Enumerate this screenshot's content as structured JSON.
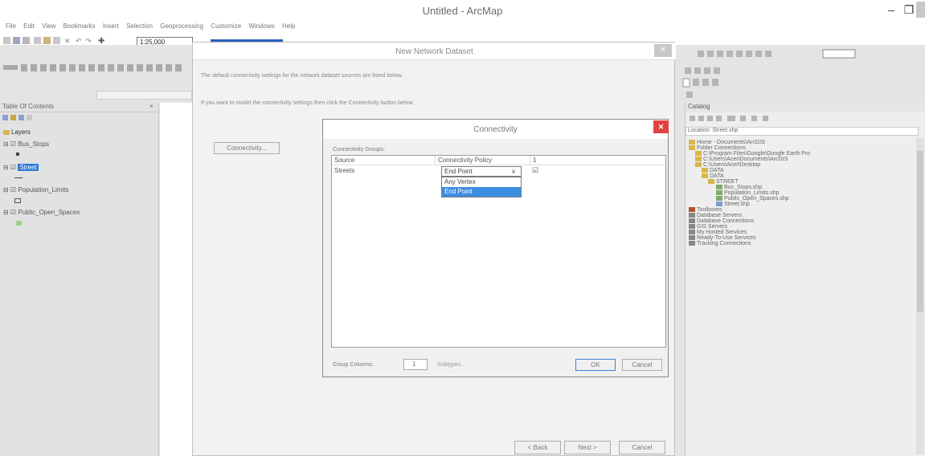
{
  "window": {
    "title": "Untitled - ArcMap",
    "minimize": "–",
    "restore": "❐"
  },
  "menubar": [
    "File",
    "Edit",
    "View",
    "Bookmarks",
    "Insert",
    "Selection",
    "Geoprocessing",
    "Customize",
    "Windows",
    "Help"
  ],
  "toolbar": {
    "scale": "1:25,000"
  },
  "toc": {
    "header": "Table Of Contents",
    "layers_label": "Layers",
    "items": [
      "Bus_Stops",
      "Street",
      "Population_Limits",
      "Public_Open_Spaces"
    ]
  },
  "catalog": {
    "header": "Catalog",
    "location_label": "Location:",
    "location_value": "Street.shp",
    "tree": [
      "Home - Documents\\ArcGIS",
      "Folder Connections",
      "C:\\Program Files\\Google\\Google Earth Pro",
      "C:\\Users\\Acer\\Documents\\ArcGIS",
      "C:\\Users\\Acer\\Desktop",
      "DATA",
      "DATA",
      "STREET",
      "Bus_Stops.shp",
      "Population_Limits.shp",
      "Public_Open_Spaces.shp",
      "Street.shp",
      "Toolboxes",
      "Database Servers",
      "Database Connections",
      "GIS Servers",
      "My Hosted Services",
      "Ready-To-Use Services",
      "Tracking Connections"
    ]
  },
  "new_network_dataset": {
    "title": "New Network Dataset",
    "close": "✕",
    "text1": "The default connectivity settings for the network dataset sources are listed below.",
    "text2": "If you want to model the connectivity settings then click the Connectivity button below.",
    "connectivity_button": "Connectivity...",
    "back_button": "< Back",
    "next_button": "Next >",
    "cancel_button": "Cancel"
  },
  "connectivity": {
    "title": "Connectivity",
    "close": "✕",
    "groups_label": "Connectivity Groups:",
    "col_source": "Source",
    "col_policy": "Connectivity Policy",
    "col_group": "1",
    "row_source": "Streets",
    "row_policy": "End Point",
    "row_group_value": "☑",
    "dropdown_options": [
      "Any Vertex",
      "End Point"
    ],
    "group_columns_label": "Group Columns:",
    "group_columns_value": "1",
    "subtypes_label": "Subtypes...",
    "ok_button": "OK",
    "cancel_button": "Cancel"
  }
}
